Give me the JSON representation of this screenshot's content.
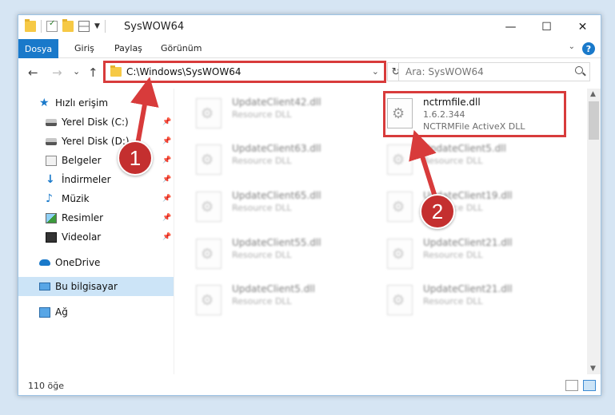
{
  "window": {
    "title": "SysWOW64",
    "buttons": {
      "minimize": "—",
      "maximize": "☐",
      "close": "✕"
    }
  },
  "ribbon": {
    "tabs": [
      "Dosya",
      "Giriş",
      "Paylaş",
      "Görünüm"
    ],
    "help": "?"
  },
  "nav": {
    "back": "←",
    "forward": "→",
    "recent": "⌄",
    "up": "↑",
    "address": "C:\\Windows\\SysWOW64",
    "refresh": "↻"
  },
  "search": {
    "placeholder": "Ara: SysWOW64"
  },
  "sidebar": {
    "items": [
      {
        "label": "Hızlı erişim",
        "icon": "star-icon"
      },
      {
        "label": "Yerel Disk (C:)",
        "icon": "drive-icon",
        "pinned": true
      },
      {
        "label": "Yerel Disk (D:)",
        "icon": "drive-icon",
        "pinned": true
      },
      {
        "label": "Belgeler",
        "icon": "documents-icon",
        "pinned": true
      },
      {
        "label": "İndirmeler",
        "icon": "download-icon",
        "pinned": true
      },
      {
        "label": "Müzik",
        "icon": "music-icon",
        "pinned": true
      },
      {
        "label": "Resimler",
        "icon": "pictures-icon",
        "pinned": true
      },
      {
        "label": "Videolar",
        "icon": "videos-icon",
        "pinned": true
      },
      {
        "label": "OneDrive",
        "icon": "cloud-icon"
      },
      {
        "label": "Bu bilgisayar",
        "icon": "computer-icon",
        "selected": true
      },
      {
        "label": "Ağ",
        "icon": "network-icon"
      }
    ]
  },
  "files": [
    {
      "name": "UpdateClient42.dll",
      "type": "Resource DLL",
      "blurred": true
    },
    {
      "name": "nctrmfile.dll",
      "version": "1.6.2.344",
      "type": "NCTRMFile ActiveX DLL",
      "highlighted": true
    },
    {
      "name": "UpdateClient63.dll",
      "type": "Resource DLL",
      "blurred": true
    },
    {
      "name": "UpdateClient5.dll",
      "type": "Resource DLL",
      "blurred": true
    },
    {
      "name": "UpdateClient65.dll",
      "type": "Resource DLL",
      "blurred": true
    },
    {
      "name": "UpdateClient19.dll",
      "type": "Resource DLL",
      "blurred": true
    },
    {
      "name": "UpdateClient55.dll",
      "type": "Resource DLL",
      "blurred": true
    },
    {
      "name": "UpdateClient21.dll",
      "type": "Resource DLL",
      "blurred": true
    },
    {
      "name": "UpdateClient5.dll",
      "type": "Resource DLL",
      "blurred": true
    },
    {
      "name": "UpdateClient21.dll",
      "type": "Resource DLL",
      "blurred": true
    }
  ],
  "status": {
    "count": "110 öğe"
  },
  "callouts": [
    {
      "number": "1",
      "color": "#c42f2f"
    },
    {
      "number": "2",
      "color": "#c42f2f"
    }
  ],
  "colors": {
    "accent": "#1979ca",
    "highlight": "#d83b3b",
    "selected": "#cce4f7"
  }
}
